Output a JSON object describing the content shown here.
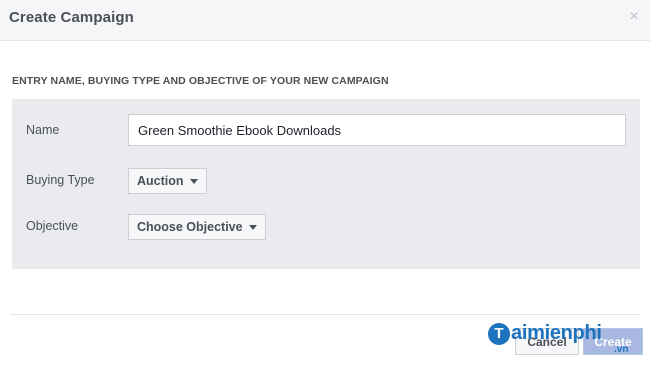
{
  "dialog": {
    "title": "Create Campaign",
    "close_glyph": "×",
    "close_icon": "close-icon"
  },
  "section": {
    "heading": "ENTRY NAME, BUYING TYPE AND OBJECTIVE OF YOUR NEW CAMPAIGN"
  },
  "form": {
    "name_label": "Name",
    "name_value": "Green Smoothie Ebook Downloads",
    "buying_type_label": "Buying Type",
    "buying_type_value": "Auction",
    "objective_label": "Objective",
    "objective_value": "Choose Objective"
  },
  "footer": {
    "cancel_label": "Cancel",
    "create_label": "Create"
  },
  "watermark": {
    "logo_letter": "T",
    "text": "aimienphi",
    "suffix": ".vn"
  },
  "colors": {
    "header_bg": "#f5f6f7",
    "panel_bg": "#e9ebee",
    "primary_disabled": "#a8b8e0",
    "watermark_blue": "#1e73be"
  }
}
